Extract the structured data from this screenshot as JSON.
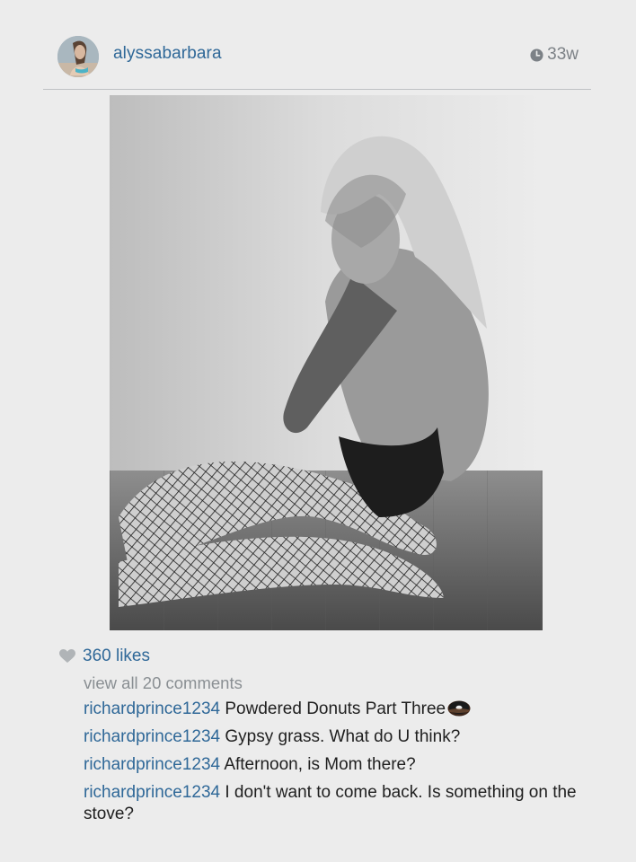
{
  "post": {
    "username": "alyssabarbara",
    "time_ago": "33w"
  },
  "icons": {
    "clock": "clock-icon",
    "heart": "heart-icon",
    "donut": "donut-emoji-icon"
  },
  "engagement": {
    "likes": "360 likes",
    "view_comments": "view all 20 comments"
  },
  "comments": [
    {
      "author": "richardprince1234",
      "text": "Powdered Donuts Part Three"
    },
    {
      "author": "richardprince1234",
      "text": "Gypsy grass. What do U think?"
    },
    {
      "author": "richardprince1234",
      "text": "Afternoon, is Mom there?"
    },
    {
      "author": "richardprince1234",
      "text": "I don't want to come back. Is something on the stove?"
    }
  ],
  "colors": {
    "link_blue": "#2f6898",
    "muted_gray": "#8a8f93",
    "background": "#ececec"
  }
}
